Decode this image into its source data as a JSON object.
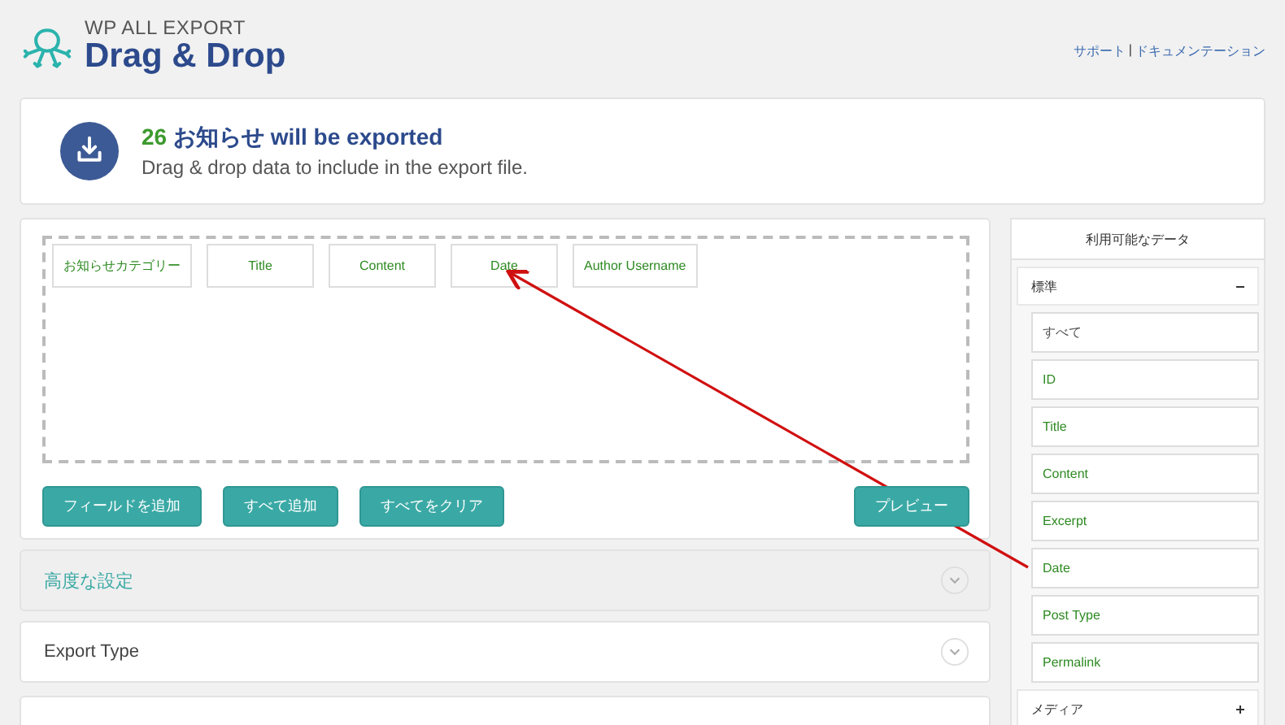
{
  "header": {
    "brand": "WP ALL EXPORT",
    "title": "Drag & Drop",
    "links": [
      "サポート",
      "ドキュメンテーション"
    ],
    "separator": "|"
  },
  "notice": {
    "count": "26",
    "headline": "お知らせ will be exported",
    "subtitle": "Drag & drop data to include in the export file."
  },
  "drop_zone": {
    "fields": [
      "お知らせカテゴリー",
      "Title",
      "Content",
      "Date",
      "Author Username"
    ]
  },
  "actions": [
    "フィールドを追加",
    "すべて追加",
    "すべてをクリア"
  ],
  "preview_button": "プレビュー",
  "sections": [
    {
      "label": "高度な設定",
      "kind": "settings",
      "expanded": false
    },
    {
      "label": "Export Type",
      "kind": "plain",
      "expanded": false
    }
  ],
  "sidebar": {
    "title": "利用可能なデータ",
    "groups": [
      {
        "label": "標準",
        "expanded": true,
        "items": [
          {
            "label": "すべて",
            "kind": "all"
          },
          {
            "label": "ID",
            "kind": "field"
          },
          {
            "label": "Title",
            "kind": "field"
          },
          {
            "label": "Content",
            "kind": "field"
          },
          {
            "label": "Excerpt",
            "kind": "field"
          },
          {
            "label": "Date",
            "kind": "field"
          },
          {
            "label": "Post Type",
            "kind": "field"
          },
          {
            "label": "Permalink",
            "kind": "field"
          }
        ]
      },
      {
        "label": "メディア",
        "expanded": false
      }
    ]
  }
}
